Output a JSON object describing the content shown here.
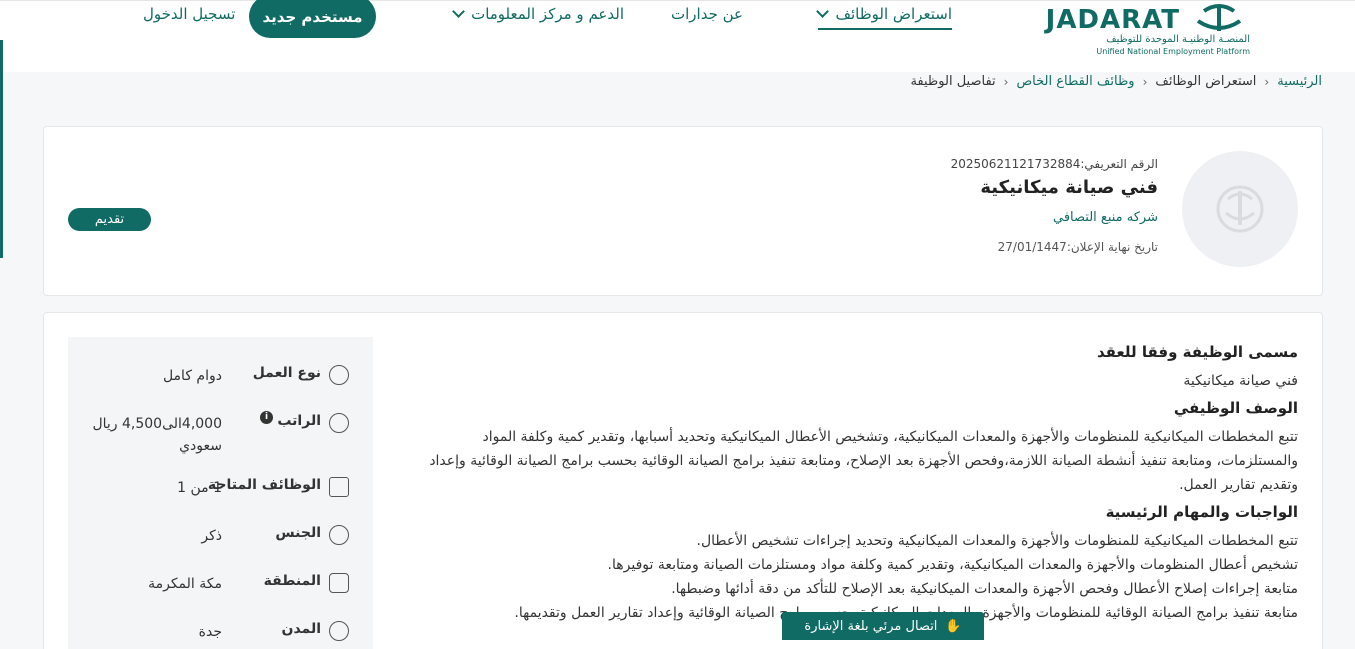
{
  "header": {
    "logo_brand": "JADARAT",
    "logo_ar": "المنصـة الوطنيـة الموحدة للتوظيف",
    "logo_en": "Unified National Employment Platform",
    "nav": {
      "browse_jobs": "استعراض الوظائف",
      "about": "عن جدارات",
      "support": "الدعم و مركز المعلومات"
    },
    "new_user": "مستخدم جديد",
    "login": "تسجيل الدخول"
  },
  "breadcrumb": [
    "الرئيسية",
    "استعراض الوظائف",
    "وظائف القطاع الخاص",
    "تفاصيل الوظيفة"
  ],
  "job": {
    "id_label": "الرقم التعريفي:20250621121732884",
    "title": "فني صيانة ميكانيكية",
    "company": "شركه منبع التصافي",
    "deadline": "تاريخ نهاية الإعلان:27/01/1447",
    "apply": "تقديم"
  },
  "details": {
    "contract_title_label": "مسمى الوظيفة وفقا للعقد",
    "contract_title": "فني صيانة ميكانيكية",
    "description_label": "الوصف الوظيفي",
    "description": "تتبع المخططات الميكانيكية للمنظومات والأجهزة والمعدات الميكانيكية، وتشخيص الأعطال الميكانيكية وتحديد أسبابها، وتقدير كمية وكلفة المواد والمستلزمات، ومتابعة تنفيذ أنشطة الصيانة اللازمة،وفحص الأجهزة بعد الإصلاح، ومتابعة تنفيذ برامج الصيانة الوقائية بحسب برامج الصيانة الوقائية وإعداد وتقديم تقارير العمل.",
    "duties_label": "الواجبات والمهام الرئيسية",
    "duties": [
      "تتبع المخططات الميكانيكية للمنظومات والأجهزة والمعدات الميكانيكية وتحديد إجراءات تشخيص الأعطال.",
      "تشخيص أعطال المنظومات والأجهزة والمعدات الميكانيكية، وتقدير كمية وكلفة مواد ومستلزمات الصيانة ومتابعة توفيرها.",
      "متابعة إجراءات إصلاح الأعطال وفحص الأجهزة والمعدات الميكانيكية بعد الإصلاح للتأكد من دقة أدائها وضبطها.",
      "متابعة تنفيذ برامج الصيانة الوقائية للمنظومات والأجهزة والمعدات الميكانيكية بحسب برامج الصيانة الوقائية وإعداد تقارير العمل وتقديمها."
    ]
  },
  "side": {
    "work_type_label": "نوع العمل",
    "work_type": "دوام كامل",
    "salary_label": "الراتب",
    "salary": "4,000الى4,500 ريال سعودي",
    "available_label": "الوظائف المتاحة",
    "available": "1 من 1",
    "gender_label": "الجنس",
    "gender": "ذكر",
    "region_label": "المنطقة",
    "region": "مكة المكرمة",
    "city_label": "المدن",
    "city": "جدة"
  },
  "sign_language": "اتصال مرئي بلغة الإشارة",
  "colors": {
    "primary": "#0f6b63",
    "background": "#f6f7f9"
  }
}
